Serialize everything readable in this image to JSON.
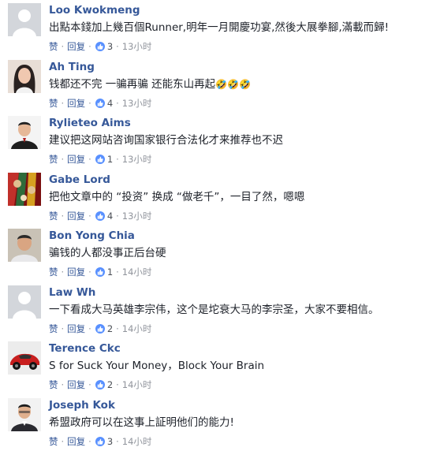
{
  "labels": {
    "like": "赞",
    "reply": "回复",
    "separator": "·"
  },
  "comments": [
    {
      "name": "Loo Kwokmeng",
      "text": "出點本錢加上幾百個Runner,明年一月開慶功宴,然後大展拳腳,滿載而歸!",
      "likes": "3",
      "time": "13小时",
      "emoji": ""
    },
    {
      "name": "Ah Ting",
      "text": "钱都还不完 一骗再骗 还能东山再起",
      "likes": "4",
      "time": "13小时",
      "emoji": "🤣🤣🤣"
    },
    {
      "name": "Rylieteo Aims",
      "text": "建议把这网站咨询国家银行合法化才来推荐也不迟",
      "likes": "1",
      "time": "13小时",
      "emoji": ""
    },
    {
      "name": "Gabe Lord",
      "text": "把他文章中的 “投资” 换成 “做老千”，一目了然，嗯嗯",
      "likes": "4",
      "time": "13小时",
      "emoji": ""
    },
    {
      "name": "Bon Yong Chia",
      "text": "骗钱的人都没事正后台硬",
      "likes": "1",
      "time": "14小时",
      "emoji": ""
    },
    {
      "name": "Law Wh",
      "text": "一下看成大马英雄李宗伟，这个是坨衰大马的李宗圣，大家不要相信。",
      "likes": "2",
      "time": "14小时",
      "emoji": ""
    },
    {
      "name": "Terence Ckc",
      "text": "S for Suck Your Money，Block Your Brain",
      "likes": "2",
      "time": "14小时",
      "emoji": ""
    },
    {
      "name": "Joseph Kok",
      "text": "希盟政府可以在这事上証明他们的能力!",
      "likes": "3",
      "time": "14小时",
      "emoji": ""
    }
  ],
  "colors": {
    "link": "#365899",
    "meta": "#90949c",
    "like_badge": "#5890ff",
    "text": "#1d2129"
  }
}
